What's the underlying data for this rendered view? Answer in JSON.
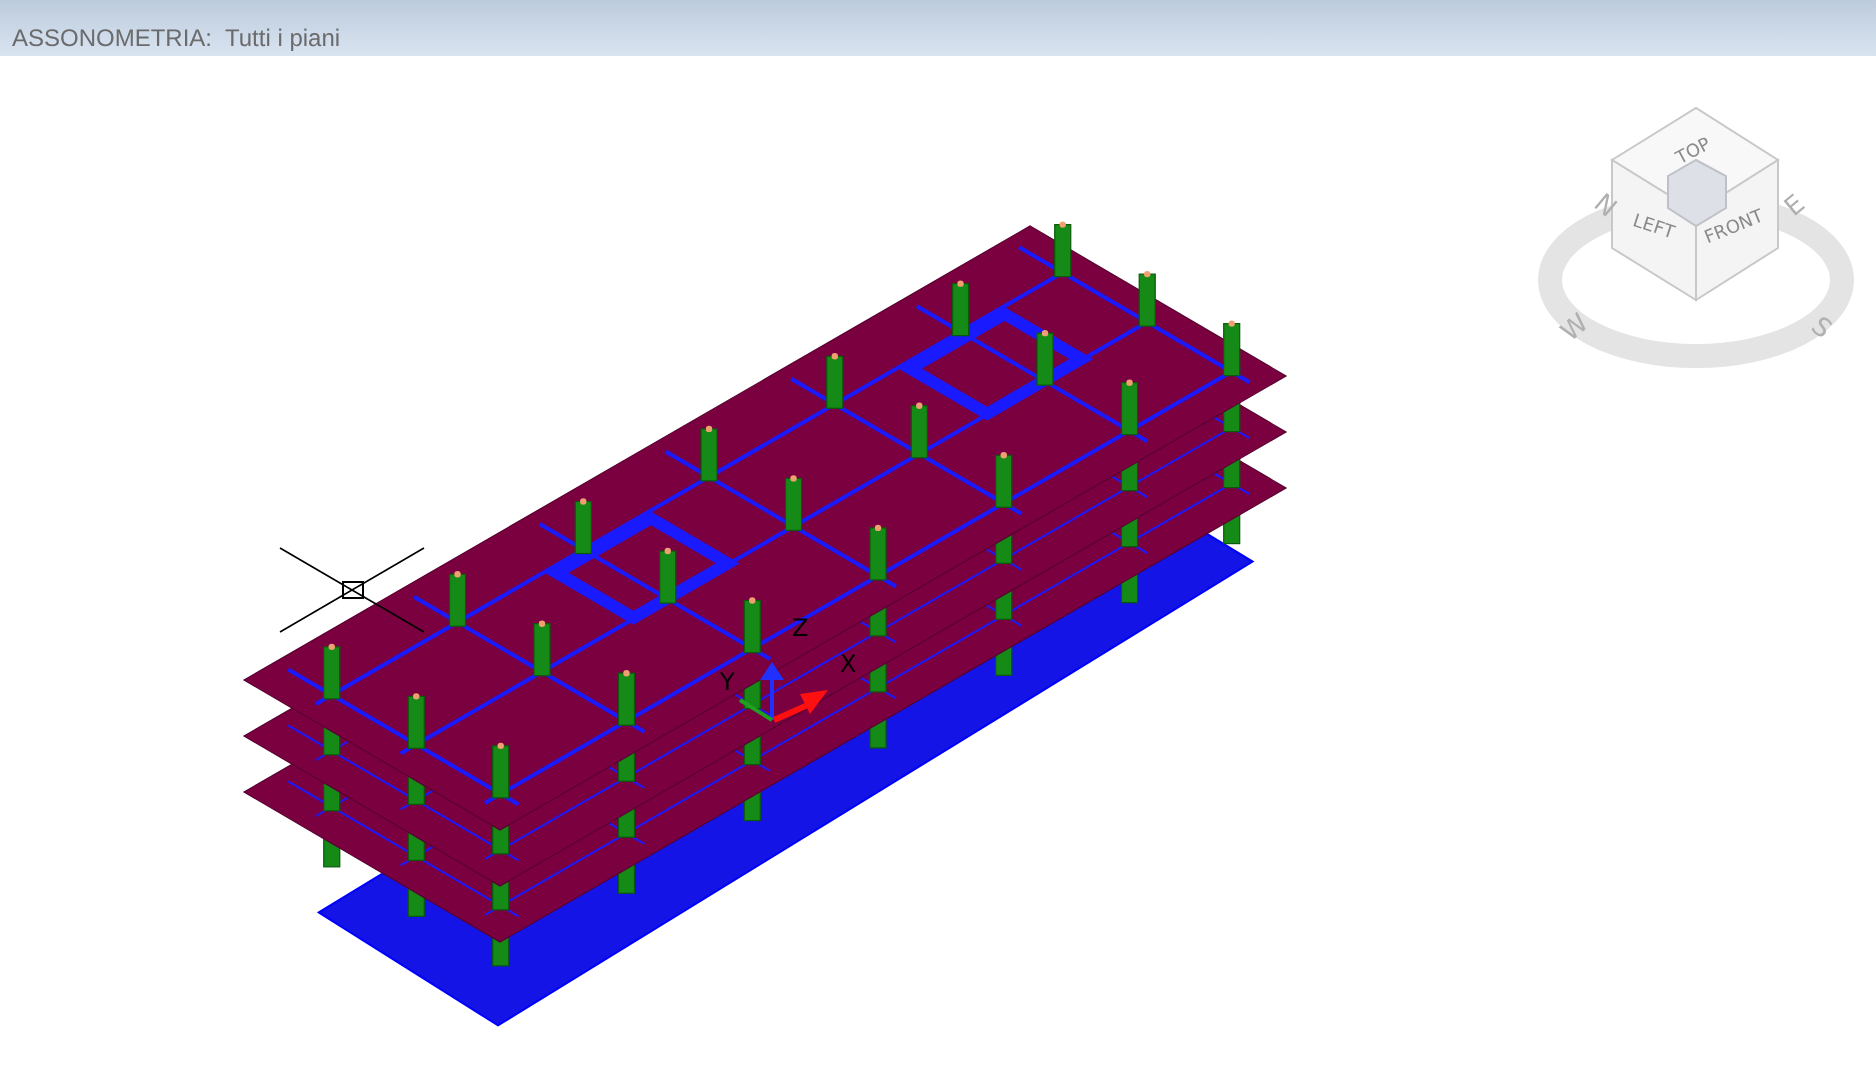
{
  "window": {
    "title": "ASSONOMETRIA:  Tutti i piani"
  },
  "viewcube": {
    "faces": [
      {
        "label": "TOP"
      },
      {
        "label": "LEFT"
      },
      {
        "label": "FRONT"
      }
    ],
    "compass": [
      {
        "label": "N"
      },
      {
        "label": "E"
      },
      {
        "label": "S"
      },
      {
        "label": "W"
      }
    ]
  },
  "ucs_axes": [
    {
      "label": "Z"
    },
    {
      "label": "X"
    },
    {
      "label": "Y"
    }
  ]
}
